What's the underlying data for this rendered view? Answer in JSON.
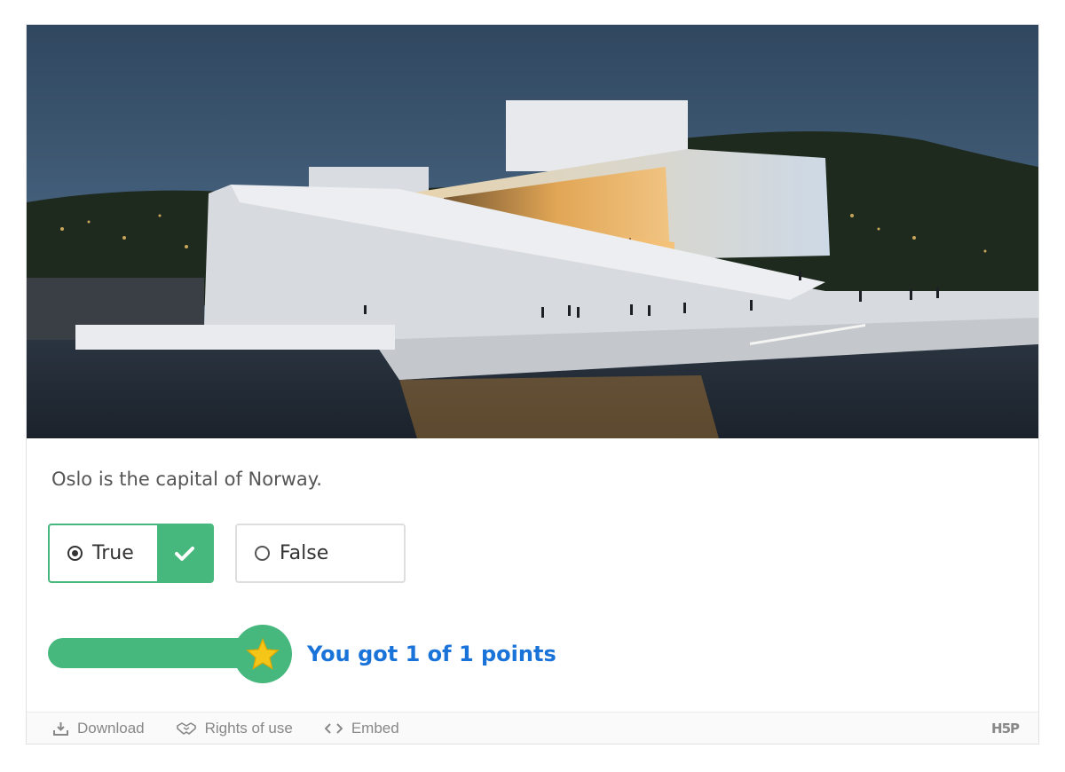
{
  "question": {
    "text": "Oslo is the capital of Norway."
  },
  "answers": [
    {
      "label": "True",
      "selected": true,
      "correct": true
    },
    {
      "label": "False",
      "selected": false,
      "correct": false
    }
  ],
  "score": {
    "text": "You got 1 of 1 points",
    "fraction": 1.0
  },
  "footer": {
    "download": "Download",
    "rights": "Rights of use",
    "embed": "Embed",
    "brand": "H5P"
  },
  "colors": {
    "correct_green": "#47b87d",
    "score_blue": "#1a73d9",
    "star_yellow": "#f5c518"
  },
  "icons": {
    "download": "download-icon",
    "rights": "handshake-icon",
    "embed": "code-icon",
    "check": "checkmark-icon",
    "star": "star-icon"
  }
}
